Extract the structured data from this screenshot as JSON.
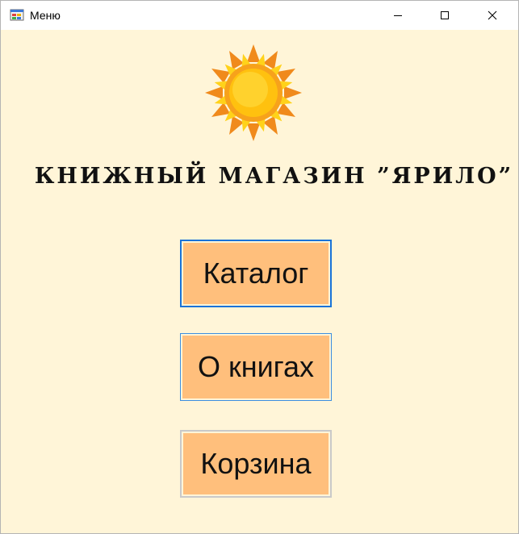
{
  "window": {
    "title": "Меню",
    "app_icon": "winforms-app-icon",
    "controls": [
      "minimize-icon",
      "maximize-icon",
      "close-icon"
    ]
  },
  "header": {
    "logo": "sun-icon",
    "shop_title": "КНИЖНЫЙ МАГАЗИН ”ЯРИЛО”"
  },
  "menu": {
    "catalog_label": "Каталог",
    "about_label": "О книгах",
    "cart_label": "Корзина"
  },
  "colors": {
    "background": "#fff5d8",
    "button_fill": "#ffbf7c",
    "focus_border": "#1a73d8"
  }
}
